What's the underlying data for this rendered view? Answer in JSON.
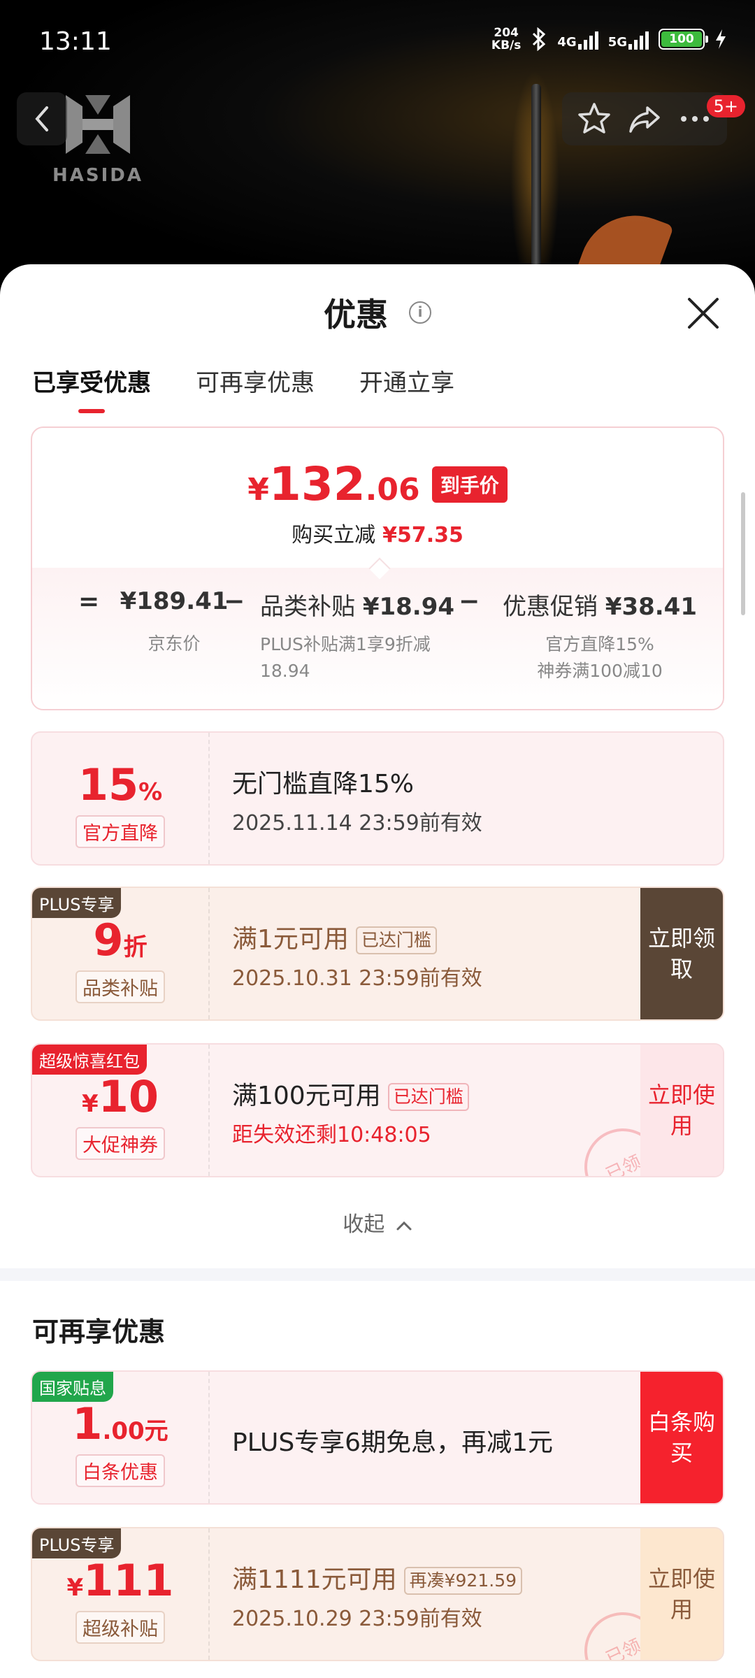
{
  "status_bar": {
    "time": "13:11",
    "speed_value": "204",
    "speed_unit": "KB/s",
    "net1": "4G",
    "net2": "5G",
    "battery": "100"
  },
  "header": {
    "brand": "HASIDA",
    "badge_count": "5+"
  },
  "sheet": {
    "title": "优惠",
    "tabs": [
      "已享受优惠",
      "可再享优惠",
      "开通立享"
    ],
    "summary": {
      "currency": "¥",
      "price_int": "132",
      "price_dec": ".06",
      "final_tag": "到手价",
      "save_label": "购买立减",
      "save_amount": "¥57.35",
      "eq": "=",
      "minus": "−",
      "jd_price": "¥189.41",
      "jd_label": "京东价",
      "subsidy_head_label": "品类补贴",
      "subsidy_head_amt": "¥18.94",
      "subsidy_desc": "PLUS补贴满1享9折减18.94",
      "promo_head_label": "优惠促销",
      "promo_head_amt": "¥38.41",
      "promo_desc1": "官方直降15%",
      "promo_desc2": "神券满100减10"
    },
    "coupons": [
      {
        "value_big": "15",
        "value_small": "%",
        "category": "官方直降",
        "line1": "无门槛直降15%",
        "line2": "2025.11.14 23:59前有效"
      },
      {
        "corner": "PLUS专享",
        "value_big": "9",
        "value_small": "折",
        "category": "品类补贴",
        "line1": "满1元可用",
        "pill": "已达门槛",
        "line2": "2025.10.31 23:59前有效",
        "action": "立即领取"
      },
      {
        "corner": "超级惊喜红包",
        "value_small": "¥",
        "value_big": "10",
        "category": "大促神券",
        "line1": "满100元可用",
        "pill": "已达门槛",
        "line2": "距失效还剩10:48:05",
        "action": "立即使用",
        "stamp": "已领"
      }
    ],
    "collapse_label": "收起",
    "section2_title": "可再享优惠",
    "coupons2": [
      {
        "corner": "国家贴息",
        "value_big": "1",
        "value_small": ".00元",
        "category": "白条优惠",
        "line1": "PLUS专享6期免息，再减1元",
        "action": "白条购买"
      },
      {
        "corner": "PLUS专享",
        "value_small": "¥",
        "value_big": "111",
        "category": "超级补贴",
        "line1": "满1111元可用",
        "pill": "再凑¥921.59",
        "line2": "2025.10.29 23:59前有效",
        "action": "立即使用",
        "stamp": "已领"
      }
    ]
  },
  "colors": {
    "accent_red": "#e8232e",
    "plus_brown": "#5a4636",
    "gov_green": "#21a64b",
    "coupon_pink": "#fdf1f2",
    "coupon_cream": "#fbefe9"
  }
}
